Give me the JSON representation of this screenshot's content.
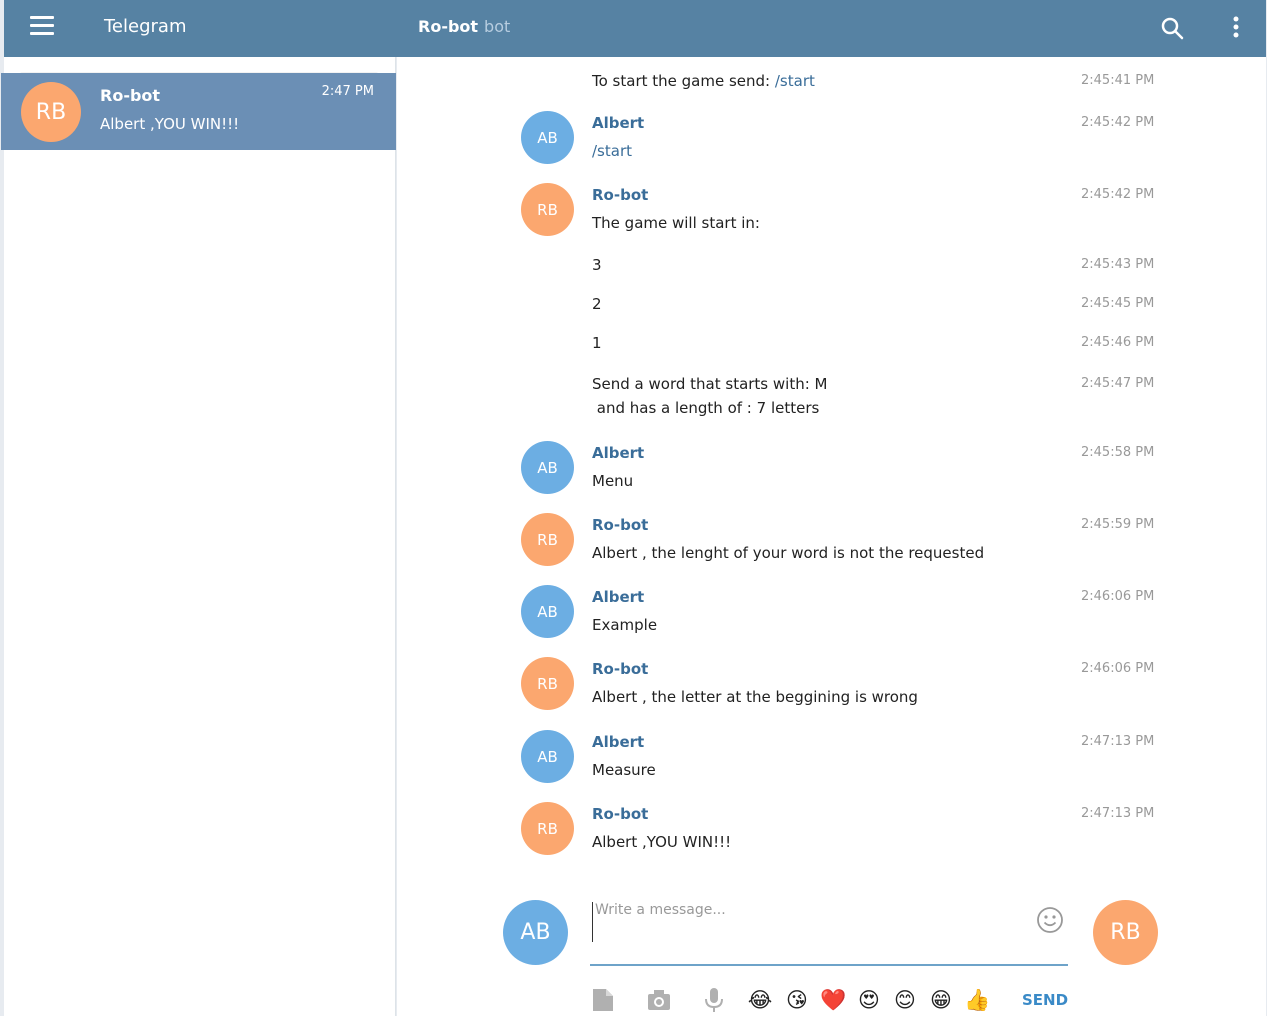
{
  "header": {
    "app_title": "Telegram",
    "peer_name": "Ro-bot",
    "peer_sub": "bot"
  },
  "sidebar": {
    "search_placeholder": "Search",
    "dialog": {
      "avatar": "RB",
      "name": "Ro-bot",
      "time": "2:47 PM",
      "last_message": "Albert ,YOU WIN!!!"
    }
  },
  "messages": [
    {
      "author": "",
      "avatar": "",
      "text": "To start the game send: ",
      "command": "/start",
      "time": "2:45:41 PM"
    },
    {
      "author": "Albert",
      "avatar": "AB",
      "text": "",
      "command": "/start",
      "time": "2:45:42 PM"
    },
    {
      "author": "Ro-bot",
      "avatar": "RB",
      "text": "The game will start in:",
      "time": "2:45:42 PM"
    },
    {
      "author": "",
      "avatar": "",
      "text": "3",
      "time": "2:45:43 PM"
    },
    {
      "author": "",
      "avatar": "",
      "text": "2",
      "time": "2:45:45 PM"
    },
    {
      "author": "",
      "avatar": "",
      "text": "1",
      "time": "2:45:46 PM"
    },
    {
      "author": "",
      "avatar": "",
      "text": "Send a word that starts with: M\n and has a length of : 7 letters",
      "time": "2:45:47 PM"
    },
    {
      "author": "Albert",
      "avatar": "AB",
      "text": "Menu",
      "time": "2:45:58 PM"
    },
    {
      "author": "Ro-bot",
      "avatar": "RB",
      "text": "Albert , the lenght of your word is not the requested",
      "time": "2:45:59 PM"
    },
    {
      "author": "Albert",
      "avatar": "AB",
      "text": "Example",
      "time": "2:46:06 PM"
    },
    {
      "author": "Ro-bot",
      "avatar": "RB",
      "text": "Albert , the letter at the beggining is wrong",
      "time": "2:46:06 PM"
    },
    {
      "author": "Albert",
      "avatar": "AB",
      "text": "Measure",
      "time": "2:47:13 PM"
    },
    {
      "author": "Ro-bot",
      "avatar": "RB",
      "text": "Albert ,YOU WIN!!!",
      "time": "2:47:13 PM"
    }
  ],
  "composer": {
    "my_avatar": "AB",
    "peer_avatar": "RB",
    "placeholder": "Write a message...",
    "send_label": "SEND",
    "emojis": [
      "😂",
      "😘",
      "❤️",
      "😍",
      "😊",
      "😁",
      "👍"
    ]
  },
  "colors": {
    "header": "#5682a3",
    "selected_dialog": "#6b8fb5",
    "avatar_ab": "#6caee3",
    "avatar_rb": "#fba76f",
    "link": "#3a6d99"
  }
}
